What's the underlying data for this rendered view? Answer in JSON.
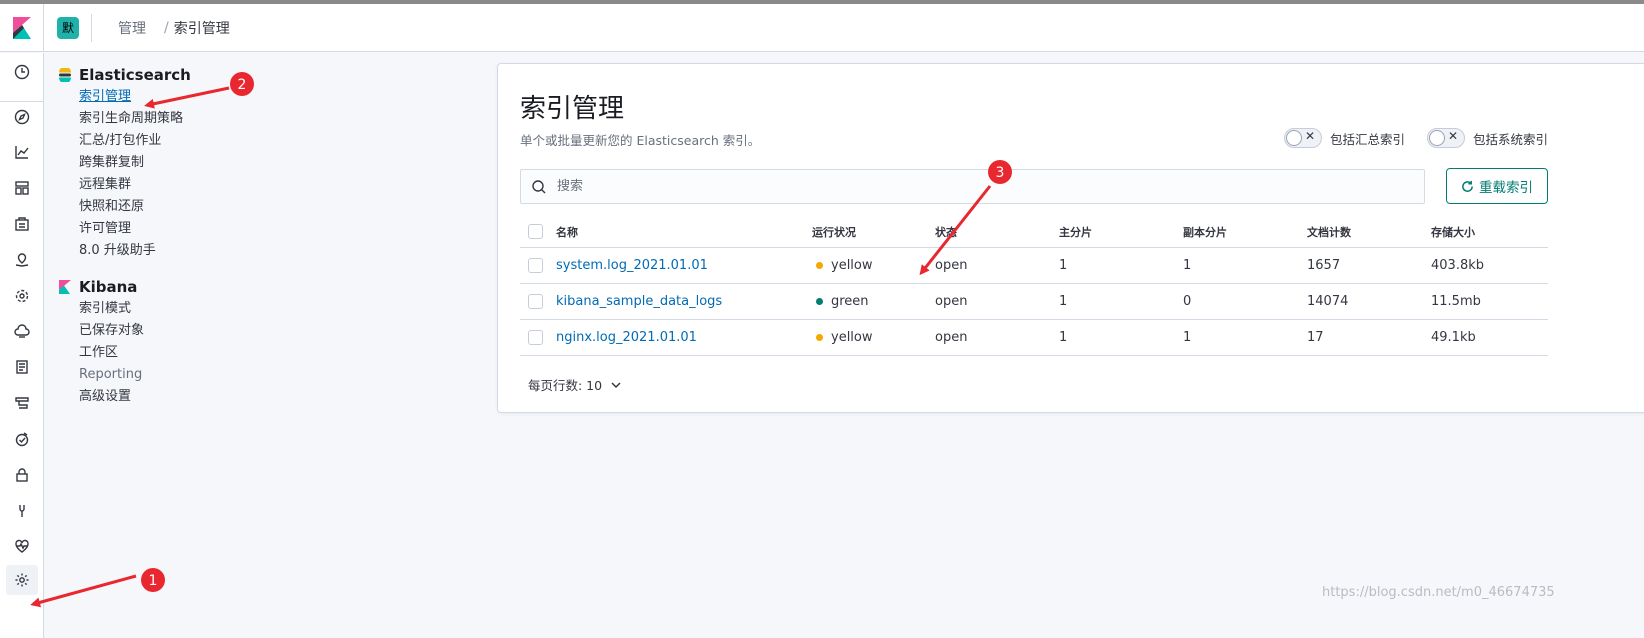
{
  "header": {
    "space_initial": "默",
    "breadcrumbs": [
      "管理",
      "索引管理"
    ]
  },
  "sidenav": {
    "groups": [
      {
        "title": "Elasticsearch",
        "items": [
          "索引管理",
          "索引生命周期策略",
          "汇总/打包作业",
          "跨集群复制",
          "远程集群",
          "快照和还原",
          "许可管理",
          "8.0 升级助手"
        ]
      },
      {
        "title": "Kibana",
        "items": [
          "索引模式",
          "已保存对象",
          "工作区",
          "Reporting",
          "高级设置"
        ]
      }
    ]
  },
  "panel": {
    "title": "索引管理",
    "subtitle": "单个或批量更新您的 Elasticsearch 索引。",
    "switches": [
      "包括汇总索引",
      "包括系统索引"
    ],
    "search_placeholder": "搜索",
    "reload_label": "重载索引",
    "columns": [
      "名称",
      "运行状况",
      "状态",
      "主分片",
      "副本分片",
      "文档计数",
      "存储大小"
    ],
    "rows": [
      {
        "name": "system.log_2021.01.01",
        "health": "yellow",
        "status": "open",
        "primary": "1",
        "replica": "1",
        "docs": "1657",
        "size": "403.8kb"
      },
      {
        "name": "kibana_sample_data_logs",
        "health": "green",
        "status": "open",
        "primary": "1",
        "replica": "0",
        "docs": "14074",
        "size": "11.5mb"
      },
      {
        "name": "nginx.log_2021.01.01",
        "health": "yellow",
        "status": "open",
        "primary": "1",
        "replica": "1",
        "docs": "17",
        "size": "49.1kb"
      }
    ],
    "pager_label": "每页行数: 10"
  },
  "colors": {
    "health_yellow": "#f5a700",
    "health_green": "#017d73",
    "annotation_red": "#e8272f",
    "link_blue": "#006bb4"
  },
  "annotations": [
    "1",
    "2",
    "3"
  ],
  "watermark": "https://blog.csdn.net/m0_46674735"
}
